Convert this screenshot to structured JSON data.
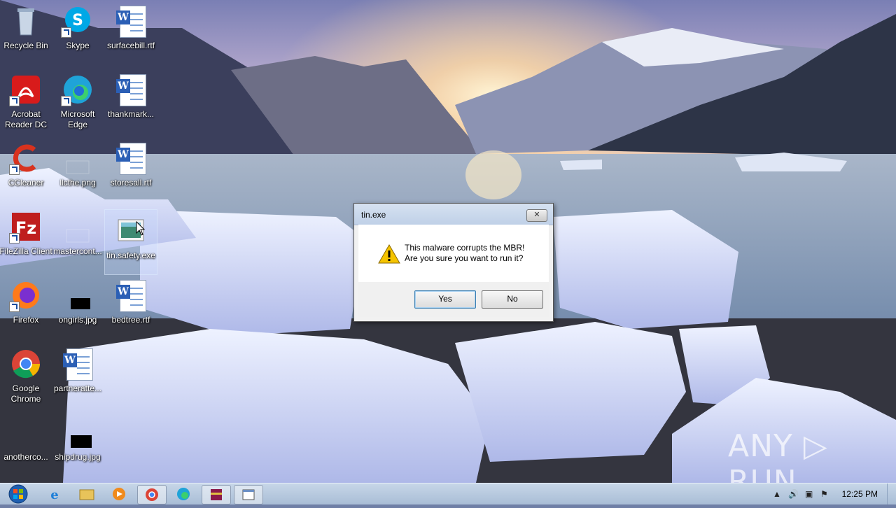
{
  "desktop": {
    "icons": [
      {
        "label": "Recycle Bin",
        "icon": "recycle-bin-icon"
      },
      {
        "label": "Skype",
        "icon": "skype-icon"
      },
      {
        "label": "surfacebill.rtf",
        "icon": "word-doc-icon"
      },
      {
        "label": "Acrobat Reader DC",
        "icon": "acrobat-icon"
      },
      {
        "label": "Microsoft Edge",
        "icon": "edge-icon"
      },
      {
        "label": "thankmark...",
        "icon": "word-doc-icon"
      },
      {
        "label": "CCleaner",
        "icon": "ccleaner-icon"
      },
      {
        "label": "llcthe.png",
        "icon": "image-file-icon"
      },
      {
        "label": "storesall.rtf",
        "icon": "word-doc-icon"
      },
      {
        "label": "FileZilla Client",
        "icon": "filezilla-icon"
      },
      {
        "label": "mastercont...",
        "icon": "file-icon"
      },
      {
        "label": "tin.safety.exe",
        "icon": "exe-icon"
      },
      {
        "label": "Firefox",
        "icon": "firefox-icon"
      },
      {
        "label": "ongirls.jpg",
        "icon": "image-file-icon"
      },
      {
        "label": "bedtree.rtf",
        "icon": "word-doc-icon"
      },
      {
        "label": "Google Chrome",
        "icon": "chrome-icon"
      },
      {
        "label": "partneratte...",
        "icon": "word-doc-icon"
      },
      {
        "label": "anotherco...",
        "icon": "file-icon"
      },
      {
        "label": "shipdrug.jpg",
        "icon": "image-file-icon"
      }
    ]
  },
  "dialog": {
    "title": "tin.exe",
    "close_label": "✕",
    "message_line1": "This malware corrupts the MBR!",
    "message_line2": "Are you sure you want to run it?",
    "yes_label": "Yes",
    "no_label": "No"
  },
  "taskbar": {
    "clock": "12:25 PM",
    "apps": [
      "internet-explorer-icon",
      "file-explorer-icon",
      "media-player-icon",
      "chrome-icon",
      "edge-icon",
      "winrar-icon",
      "dialog-app-icon"
    ]
  },
  "watermark": "ANY ▷ RUN",
  "colors": {
    "accent": "#2b5fb5",
    "taskbar": "#b7c9e0"
  }
}
